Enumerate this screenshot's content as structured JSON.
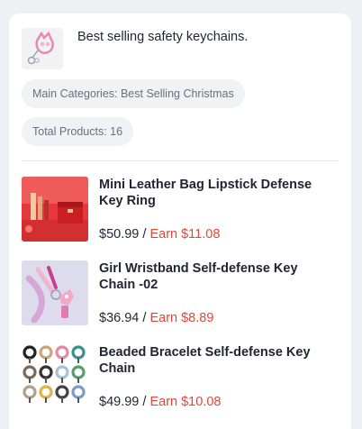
{
  "store": {
    "description": "Best selling safety keychains.",
    "thumbnail_icon": "cat-ear-keychain-icon"
  },
  "chips": {
    "category": "Main Categories: Best Selling Christmas",
    "total": "Total Products: 16"
  },
  "price_separator": "/",
  "products": [
    {
      "title": "Mini Leather Bag Lipstick Defense Key Ring",
      "price": "$50.99",
      "earn": "Earn $11.08",
      "image_icon": "lipstick-bag-photo"
    },
    {
      "title": "Girl Wristband Self-defense Key Chain -02",
      "price": "$36.94",
      "earn": "Earn $8.89",
      "image_icon": "wristband-keychain-photo"
    },
    {
      "title": "Beaded Bracelet Self-defense Key Chain",
      "price": "$49.99",
      "earn": "Earn $10.08",
      "image_icon": "beaded-bracelets-photo"
    }
  ],
  "colors": {
    "earn": "#e0473a",
    "chip_bg": "#f1f2f5",
    "page_bg": "#eef0f4"
  }
}
